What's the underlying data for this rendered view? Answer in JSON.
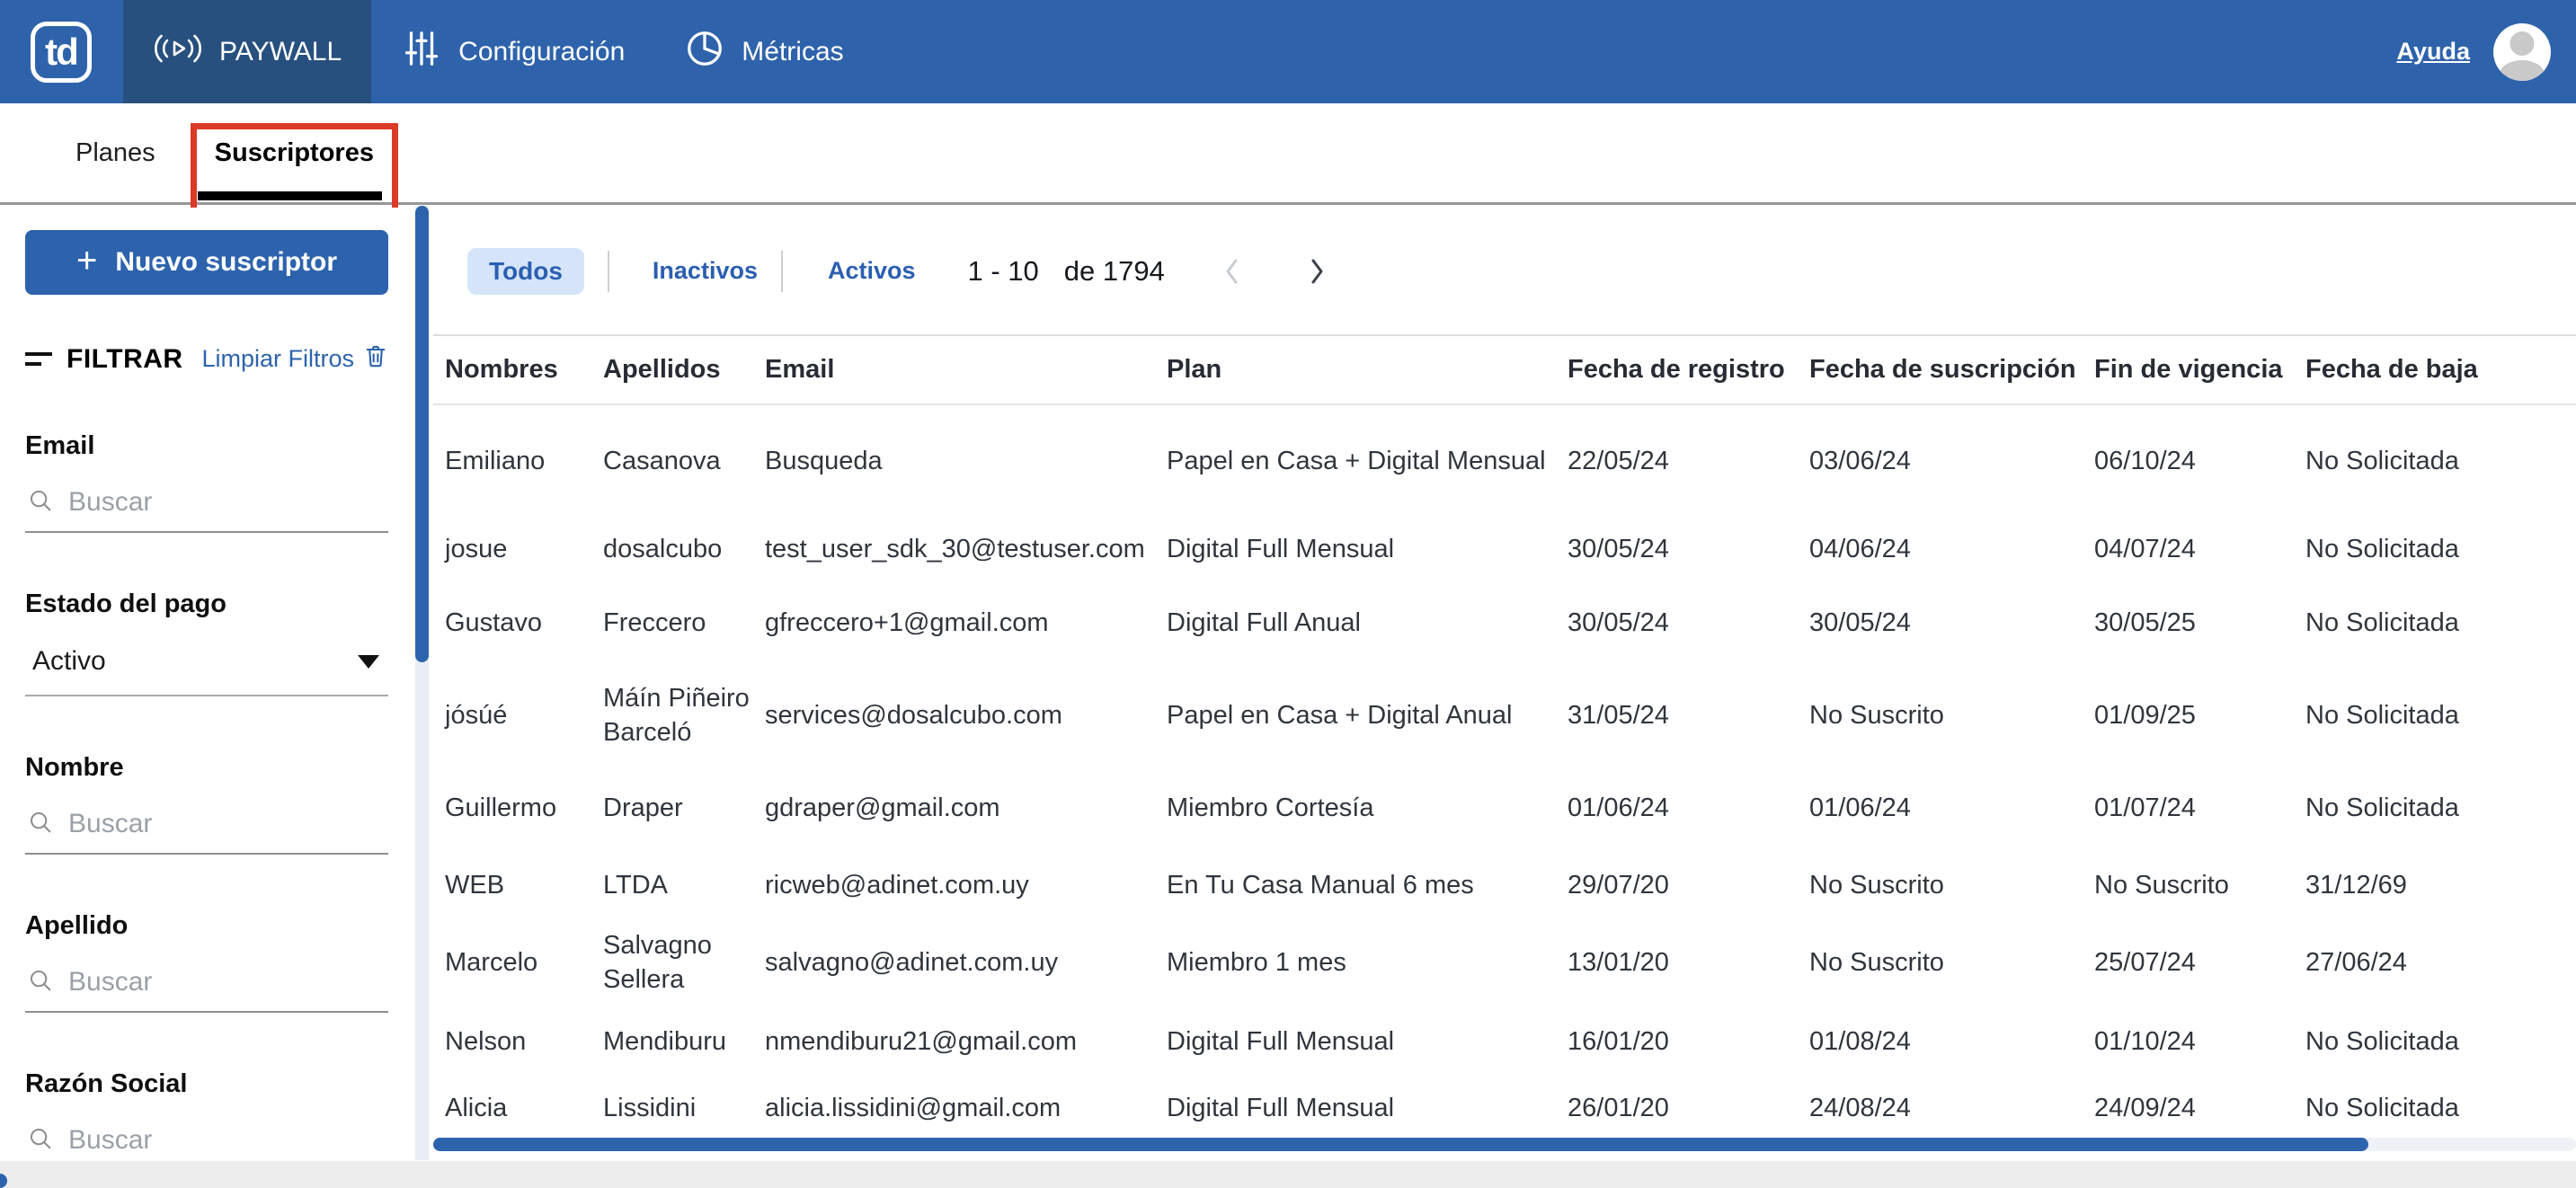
{
  "nav": {
    "brand": "td",
    "items": [
      {
        "label": "PAYWALL",
        "active": true
      },
      {
        "label": "Configuración",
        "active": false
      },
      {
        "label": "Métricas",
        "active": false
      }
    ],
    "help": "Ayuda"
  },
  "tabs": [
    {
      "label": "Planes",
      "active": false
    },
    {
      "label": "Suscriptores",
      "active": true
    }
  ],
  "sidebar": {
    "new_button_icon": "+",
    "new_button": "Nuevo suscriptor",
    "filter_title": "FILTRAR",
    "clear_filters": "Limpiar Filtros",
    "fields": [
      {
        "label": "Email",
        "type": "search",
        "placeholder": "Buscar"
      },
      {
        "label": "Estado del pago",
        "type": "select",
        "value": "Activo"
      },
      {
        "label": "Nombre",
        "type": "search",
        "placeholder": "Buscar"
      },
      {
        "label": "Apellido",
        "type": "search",
        "placeholder": "Buscar"
      },
      {
        "label": "Razón Social",
        "type": "search",
        "placeholder": "Buscar"
      }
    ]
  },
  "toolbar": {
    "filters": [
      "Todos",
      "Inactivos",
      "Activos"
    ],
    "active_filter": "Todos",
    "range": "1 - 10",
    "total": "de 1794"
  },
  "table": {
    "columns": [
      "Nombres",
      "Apellidos",
      "Email",
      "Plan",
      "Fecha de registro",
      "Fecha de suscripción",
      "Fin de vigencia",
      "Fecha de baja"
    ],
    "rows": [
      {
        "cells": [
          "Emiliano",
          "Casanova",
          "Busqueda",
          "Papel en Casa + Digital Mensual",
          "22/05/24",
          "03/06/24",
          "06/10/24",
          "No Solicitada"
        ]
      },
      {
        "cells": [
          "josue",
          "dosalcubo",
          "test_user_sdk_30@testuser.com",
          "Digital Full Mensual",
          "30/05/24",
          "04/06/24",
          "04/07/24",
          "No Solicitada"
        ]
      },
      {
        "cells": [
          "Gustavo",
          "Freccero",
          "gfreccero+1@gmail.com",
          "Digital Full Anual",
          "30/05/24",
          "30/05/24",
          "30/05/25",
          "No Solicitada"
        ]
      },
      {
        "cells": [
          "jósúé",
          "Máín Piñeiro Barceló",
          "services@dosalcubo.com",
          "Papel en Casa + Digital Anual",
          "31/05/24",
          "No Suscrito",
          "01/09/25",
          "No Solicitada"
        ]
      },
      {
        "cells": [
          "Guillermo",
          "Draper",
          "gdraper@gmail.com",
          "Miembro Cortesía",
          "01/06/24",
          "01/06/24",
          "01/07/24",
          "No Solicitada"
        ]
      },
      {
        "cells": [
          "WEB",
          "LTDA",
          "ricweb@adinet.com.uy",
          "En Tu Casa Manual 6 mes",
          "29/07/20",
          "No Suscrito",
          "No Suscrito",
          "31/12/69"
        ]
      },
      {
        "cells": [
          "Marcelo",
          "Salvagno Sellera",
          "salvagno@adinet.com.uy",
          "Miembro 1 mes",
          "13/01/20",
          "No Suscrito",
          "25/07/24",
          "27/06/24"
        ]
      },
      {
        "cells": [
          "Nelson",
          "Mendiburu",
          "nmendiburu21@gmail.com",
          "Digital Full Mensual",
          "16/01/20",
          "01/08/24",
          "01/10/24",
          "No Solicitada"
        ]
      },
      {
        "cells": [
          "Alicia",
          "Lissidini",
          "alicia.lissidini@gmail.com",
          "Digital Full Mensual",
          "26/01/20",
          "24/08/24",
          "24/09/24",
          "No Solicitada"
        ]
      }
    ]
  },
  "colors": {
    "nav_bg": "#2e63ab",
    "nav_active_bg": "#27507e",
    "accent_blue": "#2d63ad",
    "pill_bg": "#d5e4f9",
    "annotation_red": "#db3a26",
    "scrollbar_blue": "#2d63ad"
  }
}
